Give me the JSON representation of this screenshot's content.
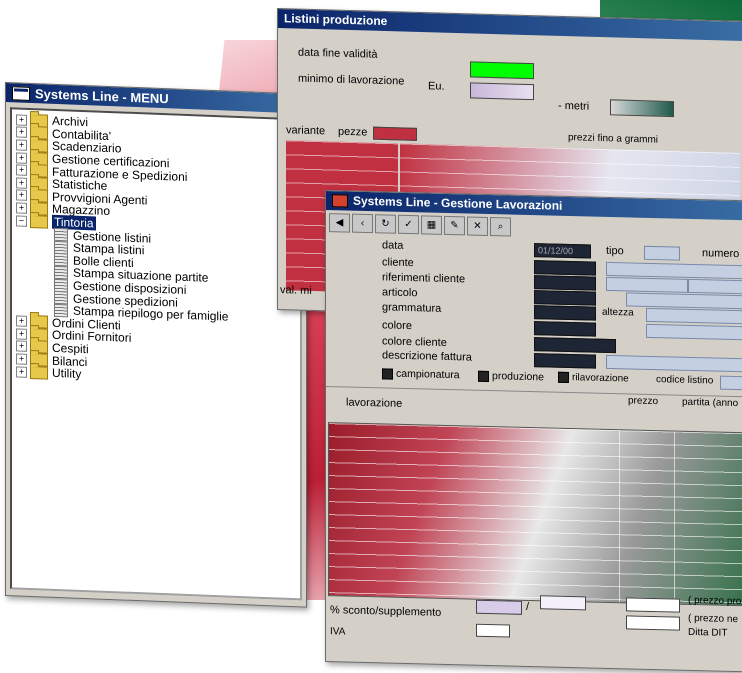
{
  "menu_window": {
    "title": "Systems Line - MENU",
    "items": [
      {
        "label": "Archivi",
        "expander": "+"
      },
      {
        "label": "Contabilita'",
        "expander": "+"
      },
      {
        "label": "Scadenziario",
        "expander": "+"
      },
      {
        "label": "Gestione certificazioni",
        "expander": "+"
      },
      {
        "label": "Fatturazione e Spedizioni",
        "expander": "+"
      },
      {
        "label": "Statistiche",
        "expander": "+"
      },
      {
        "label": "Provvigioni Agenti",
        "expander": "+"
      },
      {
        "label": "Magazzino",
        "expander": "+"
      },
      {
        "label": "Tintoria",
        "expander": "−"
      },
      {
        "label": "Ordini Clienti",
        "expander": "+"
      },
      {
        "label": "Ordini Fornitori",
        "expander": "+"
      },
      {
        "label": "Cespiti",
        "expander": "+"
      },
      {
        "label": "Bilanci",
        "expander": "+"
      },
      {
        "label": "Utility",
        "expander": "+"
      }
    ],
    "tintoria_children": [
      "Gestione listini",
      "Stampa  listini",
      "Bolle   clienti",
      "Stampa  situazione partite",
      "Gestione disposizioni",
      "Gestione spedizioni",
      "Stampa  riepilogo per famiglie"
    ]
  },
  "listini_window": {
    "title": "Listini produzione",
    "data_fine_validita": "data fine validità",
    "minimo_lavorazione": "minimo di lavorazione",
    "eu": "Eu.",
    "metri": "- metri",
    "variante": "variante",
    "pezze": "pezze",
    "prezzi": "prezzi fino a grammi",
    "val": "val. mi"
  },
  "lavor_window": {
    "title": "Systems Line - Gestione Lavorazioni",
    "data_label": "data",
    "data_value": "01/12/00",
    "tipo_label": "tipo",
    "numero_label": "numero",
    "fields": [
      "cliente",
      "riferimenti cliente",
      "articolo",
      "grammatura",
      "colore",
      "colore cliente",
      "descrizione fattura"
    ],
    "altezza": "altezza",
    "check_campionatura": "campionatura",
    "check_produzione": "produzione",
    "check_rilavorazione": "rilavorazione",
    "codice_listino": "codice listino",
    "lavorazione": "lavorazione",
    "prezzo": "prezzo",
    "partita": "partita (anno",
    "sconto": "% sconto/supplemento",
    "slash": "/",
    "iva": "IVA",
    "prezzo_pro": "( prezzo pro",
    "prezzo_ne": "( prezzo ne",
    "ditta": "Ditta DIT"
  },
  "colors": {
    "title_start": "#0a246a",
    "title_end": "#3a6ea5",
    "green_box": "#00ff00",
    "panel": "#d4d0c8"
  }
}
